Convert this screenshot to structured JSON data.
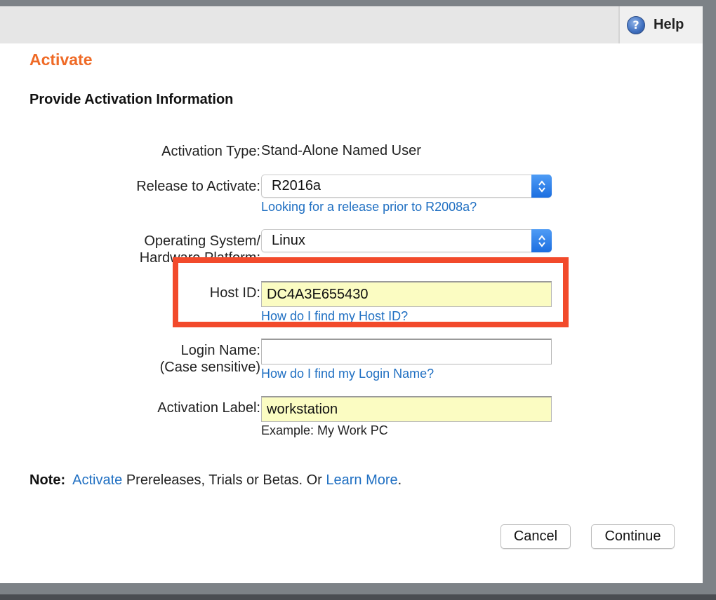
{
  "header": {
    "help_label": "Help",
    "help_icon": "help-question-icon"
  },
  "page": {
    "title": "Activate",
    "section_title": "Provide Activation Information"
  },
  "form": {
    "activation_type": {
      "label": "Activation Type:",
      "value": "Stand-Alone Named User"
    },
    "release": {
      "label": "Release to Activate:",
      "value": "R2016a",
      "help_link": "Looking for a release prior to R2008a?"
    },
    "os": {
      "label_line1": "Operating System/",
      "label_line2": "Hardware Platform:",
      "value": "Linux"
    },
    "host_id": {
      "label": "Host ID:",
      "value": "DC4A3E655430",
      "help_link": "How do I find my Host ID?"
    },
    "login_name": {
      "label_line1": "Login Name:",
      "label_line2": "(Case sensitive)",
      "value": "",
      "help_link": "How do I find my Login Name?"
    },
    "activation_label": {
      "label": "Activation Label:",
      "value": "workstation",
      "example": "Example: My Work PC"
    }
  },
  "note": {
    "prefix": "Note:",
    "activate_link": "Activate",
    "middle": " Prereleases, Trials or Betas. Or ",
    "learn_more_link": "Learn More",
    "suffix": "."
  },
  "buttons": {
    "cancel": "Cancel",
    "continue": "Continue"
  },
  "colors": {
    "title_orange": "#ef6a26",
    "link_blue": "#1f6fc2",
    "highlight_red": "#f24a2b",
    "autofill_yellow": "#fbfcc2"
  }
}
